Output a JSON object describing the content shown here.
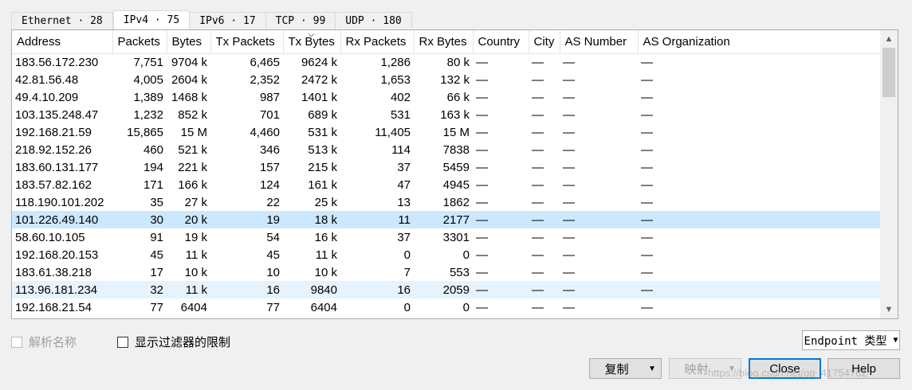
{
  "tabs": [
    {
      "label": "Ethernet · 28"
    },
    {
      "label": "IPv4 · 75"
    },
    {
      "label": "IPv6 · 17"
    },
    {
      "label": "TCP · 99"
    },
    {
      "label": "UDP · 180"
    }
  ],
  "table": {
    "columns": [
      "Address",
      "Packets",
      "Bytes",
      "Tx Packets",
      "Tx Bytes",
      "Rx Packets",
      "Rx Bytes",
      "Country",
      "City",
      "AS Number",
      "AS Organization"
    ],
    "rows": [
      [
        "183.56.172.230",
        "7,751",
        "9704 k",
        "6,465",
        "9624 k",
        "1,286",
        "80 k",
        "—",
        "—",
        "—",
        "—"
      ],
      [
        "42.81.56.48",
        "4,005",
        "2604 k",
        "2,352",
        "2472 k",
        "1,653",
        "132 k",
        "—",
        "—",
        "—",
        "—"
      ],
      [
        "49.4.10.209",
        "1,389",
        "1468 k",
        "987",
        "1401 k",
        "402",
        "66 k",
        "—",
        "—",
        "—",
        "—"
      ],
      [
        "103.135.248.47",
        "1,232",
        "852 k",
        "701",
        "689 k",
        "531",
        "163 k",
        "—",
        "—",
        "—",
        "—"
      ],
      [
        "192.168.21.59",
        "15,865",
        "15 M",
        "4,460",
        "531 k",
        "11,405",
        "15 M",
        "—",
        "—",
        "—",
        "—"
      ],
      [
        "218.92.152.26",
        "460",
        "521 k",
        "346",
        "513 k",
        "114",
        "7838",
        "—",
        "—",
        "—",
        "—"
      ],
      [
        "183.60.131.177",
        "194",
        "221 k",
        "157",
        "215 k",
        "37",
        "5459",
        "—",
        "—",
        "—",
        "—"
      ],
      [
        "183.57.82.162",
        "171",
        "166 k",
        "124",
        "161 k",
        "47",
        "4945",
        "—",
        "—",
        "—",
        "—"
      ],
      [
        "118.190.101.202",
        "35",
        "27 k",
        "22",
        "25 k",
        "13",
        "1862",
        "—",
        "—",
        "—",
        "—"
      ],
      [
        "101.226.49.140",
        "30",
        "20 k",
        "19",
        "18 k",
        "11",
        "2177",
        "—",
        "—",
        "—",
        "—"
      ],
      [
        "58.60.10.105",
        "91",
        "19 k",
        "54",
        "16 k",
        "37",
        "3301",
        "—",
        "—",
        "—",
        "—"
      ],
      [
        "192.168.20.153",
        "45",
        "11 k",
        "45",
        "11 k",
        "0",
        "0",
        "—",
        "—",
        "—",
        "—"
      ],
      [
        "183.61.38.218",
        "17",
        "10 k",
        "10",
        "10 k",
        "7",
        "553",
        "—",
        "—",
        "—",
        "—"
      ],
      [
        "113.96.181.234",
        "32",
        "11 k",
        "16",
        "9840",
        "16",
        "2059",
        "—",
        "—",
        "—",
        "—"
      ],
      [
        "192.168.21.54",
        "77",
        "6404",
        "77",
        "6404",
        "0",
        "0",
        "—",
        "—",
        "—",
        "—"
      ]
    ],
    "selected_row": 9,
    "hover_row": 13
  },
  "options": {
    "resolve_names": "解析名称",
    "limit_to_filter": "显示过滤器的限制"
  },
  "buttons": {
    "endpoint_type": "Endpoint 类型",
    "copy": "复制",
    "map": "映射",
    "close": "Close",
    "help": "Help"
  },
  "watermark": "https://blog.csdn.net/qq_41754762",
  "icons": {
    "sort": "sort-desc-icon",
    "dropdown": "chevron-down-icon",
    "scroll_up": "arrow-up-icon",
    "scroll_down": "arrow-down-icon"
  }
}
